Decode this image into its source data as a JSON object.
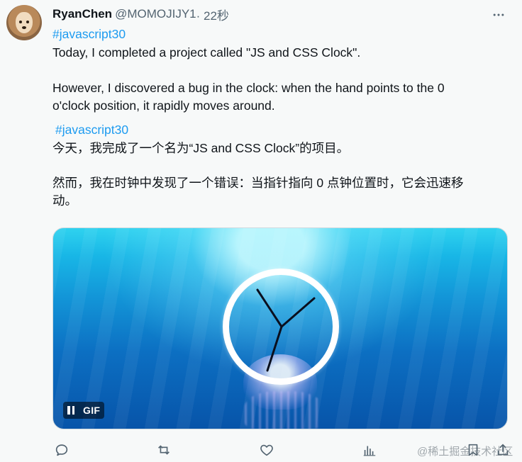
{
  "tweet": {
    "author": {
      "name": "RyanChen",
      "handle": "@MOMOJIJY1",
      "time": " · 22秒"
    },
    "lines_en": {
      "hashtag": "#javascript30",
      "line1": "Today, I completed a project called \"JS and CSS Clock\".",
      "line2": "However, I discovered a bug in the clock: when the hand points to the 0",
      "line3": "o'clock position, it rapidly moves around."
    },
    "lines_zh": {
      "hashtag": "#javascript30",
      "line1": "今天，我完成了一个名为“JS and CSS Clock”的项目。",
      "line2": "然而，我在时钟中发现了一个错误：当指针指向 0 点钟位置时，它会迅速移",
      "line3": "动。"
    },
    "media": {
      "type": "gif",
      "badge": "GIF",
      "pause_icon": "pause-icon"
    },
    "actions": [
      {
        "name": "reply",
        "icon": "reply-icon"
      },
      {
        "name": "retweet",
        "icon": "retweet-icon"
      },
      {
        "name": "like",
        "icon": "heart-icon"
      },
      {
        "name": "views",
        "icon": "analytics-icon"
      },
      {
        "name": "bookmark",
        "icon": "bookmark-icon"
      },
      {
        "name": "share",
        "icon": "share-icon"
      }
    ],
    "more_icon": "more-icon"
  },
  "watermark": "@稀土掘金技术社区",
  "colors": {
    "link": "#1d9bf0",
    "text": "#0f1419",
    "muted": "#536471",
    "background": "#f7f9f9"
  }
}
